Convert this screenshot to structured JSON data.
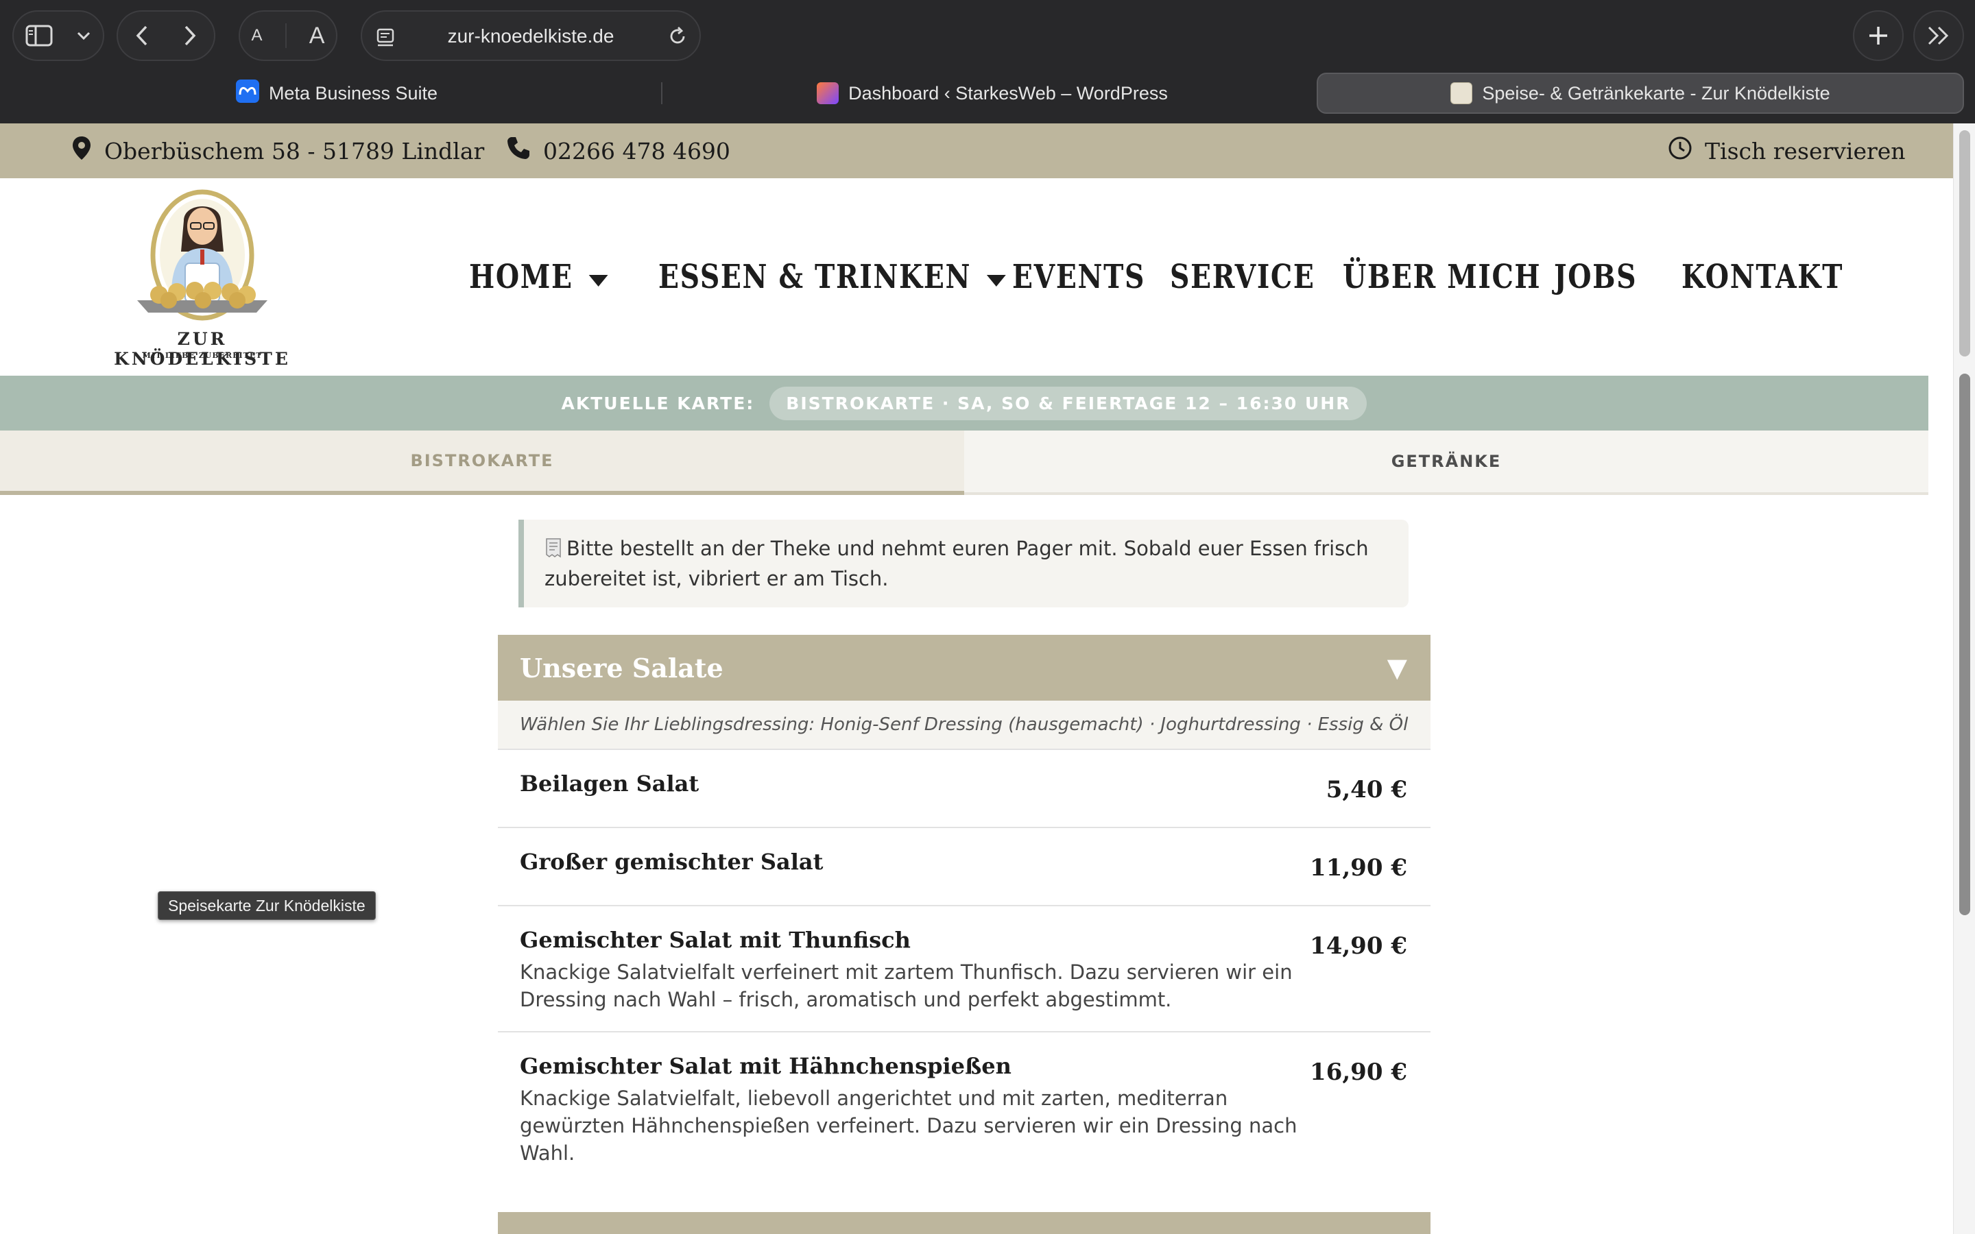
{
  "browser": {
    "url": "zur-knoedelkiste.de",
    "text_small": "A",
    "text_large": "A",
    "tabs": [
      {
        "label": "Meta Business Suite",
        "active": false
      },
      {
        "label": "Dashboard ‹ StarkesWeb – WordPress",
        "active": false
      },
      {
        "label": "Speise- & Getränkekarte - Zur Knödelkiste",
        "active": true
      }
    ]
  },
  "topbar": {
    "address": "Oberbüschem 58 - 51789 Lindlar",
    "phone": "02266 478 4690",
    "reserve": "Tisch reservieren"
  },
  "logo": {
    "name": "ZUR KNÖDELKISTE",
    "tagline": "MIT LIEBE ZUBEREITET"
  },
  "nav": {
    "items": [
      {
        "label": "HOME",
        "dropdown": true
      },
      {
        "label": "ESSEN & TRINKEN",
        "dropdown": true
      },
      {
        "label": "EVENTS",
        "dropdown": false
      },
      {
        "label": "SERVICE",
        "dropdown": false
      },
      {
        "label": "ÜBER MICH",
        "dropdown": false
      },
      {
        "label": "JOBS",
        "dropdown": false
      },
      {
        "label": "KONTAKT",
        "dropdown": false
      }
    ]
  },
  "current_menu": {
    "label": "AKTUELLE KARTE:",
    "value": "BISTROKARTE · SA, SO & FEIERTAGE 12 – 16:30 UHR"
  },
  "menu_tabs": [
    {
      "label": "BISTROKARTE",
      "active": true
    },
    {
      "label": "GETRÄNKE",
      "active": false
    }
  ],
  "notice": {
    "icon": "receipt-icon",
    "text": "Bitte bestellt an der Theke und nehmt euren Pager mit. Sobald euer Essen frisch zubereitet ist, vibriert er am Tisch."
  },
  "category": {
    "title": "Unsere Salate",
    "arrow": "▼",
    "note": "Wählen Sie Ihr Lieblingsdressing: Honig-Senf Dressing (hausgemacht) · Joghurtdressing · Essig & Öl",
    "dishes": [
      {
        "name": "Beilagen Salat",
        "price": "5,40 €",
        "desc": ""
      },
      {
        "name": "Großer gemischter Salat",
        "price": "11,90 €",
        "desc": ""
      },
      {
        "name": "Gemischter Salat mit Thunfisch",
        "price": "14,90 €",
        "desc": "Knackige Salatvielfalt verfeinert mit zartem Thunfisch. Dazu servieren wir ein Dressing nach Wahl – frisch, aromatisch und perfekt abgestimmt."
      },
      {
        "name": "Gemischter Salat mit Hähnchenspießen",
        "price": "16,90 €",
        "desc": "Knackige Salatvielfalt, liebevoll angerichtet und mit zarten, mediterran gewürzten Hähnchenspießen verfeinert. Dazu servieren wir ein Dressing nach Wahl."
      }
    ]
  },
  "tooltip": "Speisekarte Zur Knödelkiste",
  "colors": {
    "chrome_bg": "#28282a",
    "brand_beige": "#bdb69d",
    "sage": "#a9bcb1",
    "panel": "#f5f4f0"
  }
}
